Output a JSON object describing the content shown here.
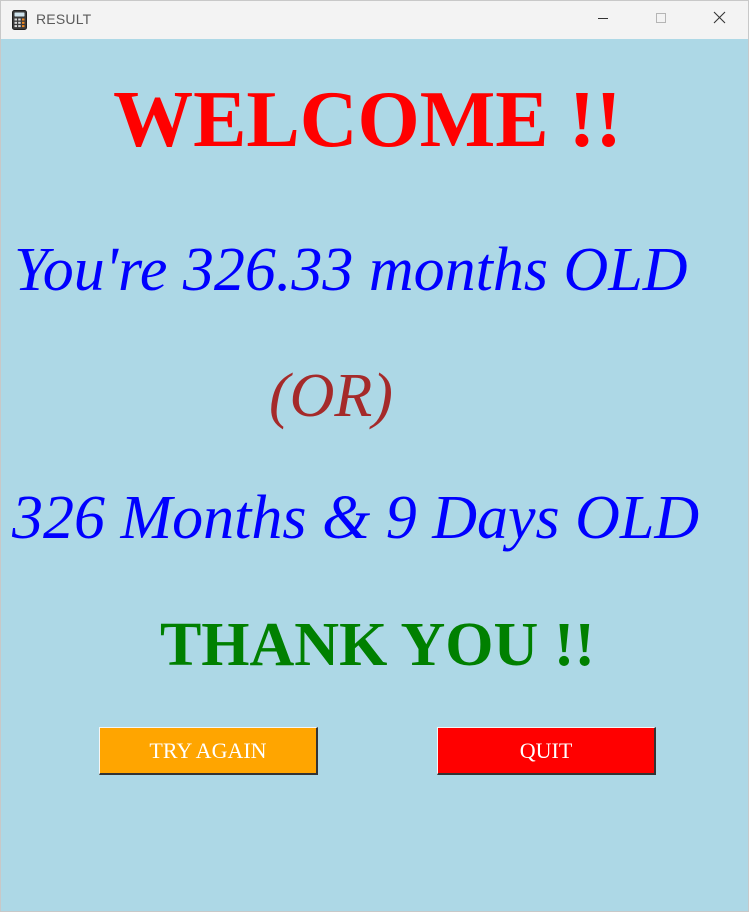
{
  "window": {
    "title": "RESULT",
    "icon": "calculator-icon",
    "controls": [
      "minimize-icon",
      "maximize-icon",
      "close-icon"
    ]
  },
  "content": {
    "welcome": "WELCOME !!",
    "age_months": "You're 326.33 months OLD",
    "or_text": "(OR)",
    "age_months_days": "326 Months & 9 Days OLD",
    "thanks": "THANK YOU !!"
  },
  "buttons": {
    "try_again": "TRY AGAIN",
    "quit": "QUIT"
  },
  "colors": {
    "background": "#add8e6",
    "welcome": "#ff0000",
    "age_text": "#0000ff",
    "or_text": "#a52a2a",
    "thanks": "#008000",
    "try_again_button": "#ffa500",
    "quit_button": "#ff0000"
  }
}
